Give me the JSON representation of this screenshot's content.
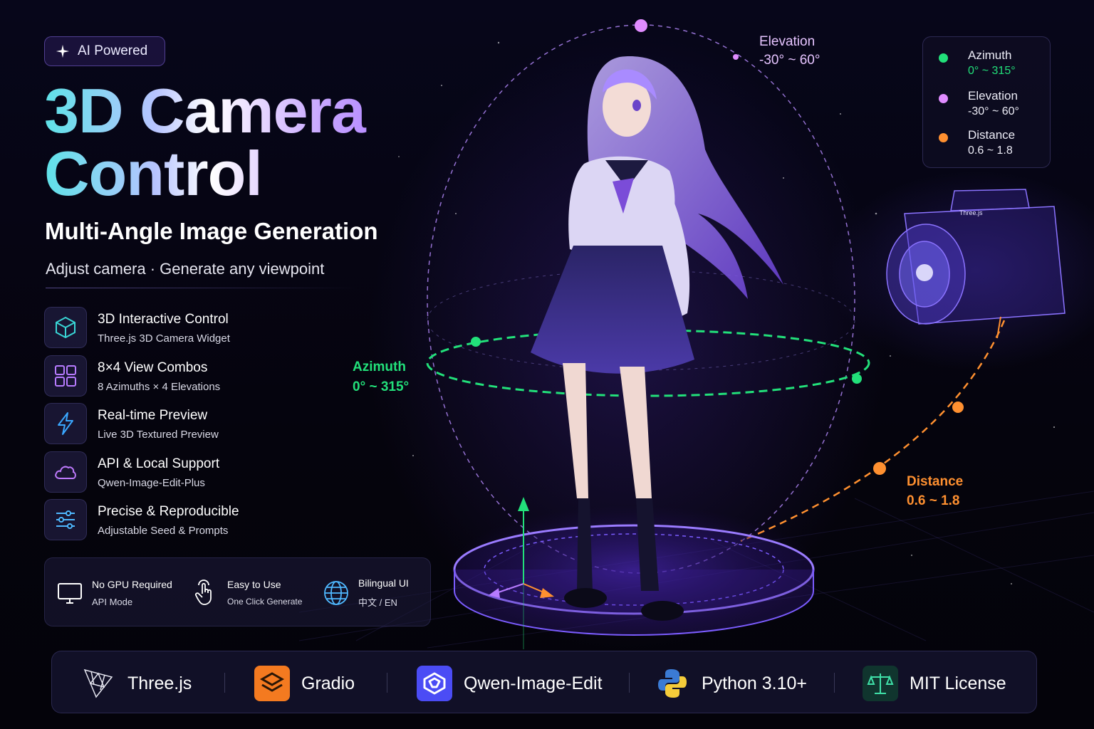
{
  "badge": {
    "icon": "sparkle-icon",
    "label": "AI Powered"
  },
  "hero": {
    "title_line1": "3D Camera",
    "title_line2": "Control",
    "subtitle": "Multi-Angle Image Generation",
    "tagline": "Adjust camera · Generate any viewpoint"
  },
  "features": [
    {
      "icon": "cube-icon",
      "title": "3D Interactive Control",
      "sub": "Three.js 3D Camera Widget",
      "color": "#39d6d6"
    },
    {
      "icon": "grid-icon",
      "title": "8×4 View Combos",
      "sub": "8 Azimuths × 4 Elevations",
      "color": "#b77bff"
    },
    {
      "icon": "lightning-icon",
      "title": "Real-time Preview",
      "sub": "Live 3D Textured Preview",
      "color": "#3aa7ff"
    },
    {
      "icon": "cloud-icon",
      "title": "API & Local Support",
      "sub": "Qwen-Image-Edit-Plus",
      "color": "#c07bff"
    },
    {
      "icon": "sliders-icon",
      "title": "Precise & Reproducible",
      "sub": "Adjustable Seed & Prompts",
      "color": "#4fb8ff"
    }
  ],
  "info": [
    {
      "icon": "monitor-icon",
      "t1": "No GPU Required",
      "t2": "API Mode"
    },
    {
      "icon": "tap-icon",
      "t1": "Easy to Use",
      "t2": "One Click Generate"
    },
    {
      "icon": "globe-icon",
      "t1": "Bilingual UI",
      "t2": "中文 / EN"
    }
  ],
  "legend": [
    {
      "name": "Azimuth",
      "range": "0° ~ 315°",
      "color": "#22e07a"
    },
    {
      "name": "Elevation",
      "range": "-30° ~ 60°",
      "color": "#e08cff"
    },
    {
      "name": "Distance",
      "range": "0.6 ~ 1.8",
      "color": "#ff9030"
    }
  ],
  "scene": {
    "elevation_label": "Elevation",
    "elevation_range": "-30° ~ 60°",
    "azimuth_label": "Azimuth",
    "azimuth_range": "0° ~ 315°",
    "distance_label": "Distance",
    "distance_range": "0.6 ~ 1.8",
    "camera_brand": "Three.js"
  },
  "tech": [
    {
      "icon": "threejs-icon",
      "label": "Three.js"
    },
    {
      "icon": "gradio-icon",
      "label": "Gradio"
    },
    {
      "icon": "qwen-icon",
      "label": "Qwen-Image-Edit"
    },
    {
      "icon": "python-icon",
      "label": "Python 3.10+"
    },
    {
      "icon": "scale-icon",
      "label": "MIT License"
    }
  ],
  "colors": {
    "azimuth": "#22e07a",
    "elevation": "#e08cff",
    "distance": "#ff9030",
    "accent": "#8a6bff"
  }
}
